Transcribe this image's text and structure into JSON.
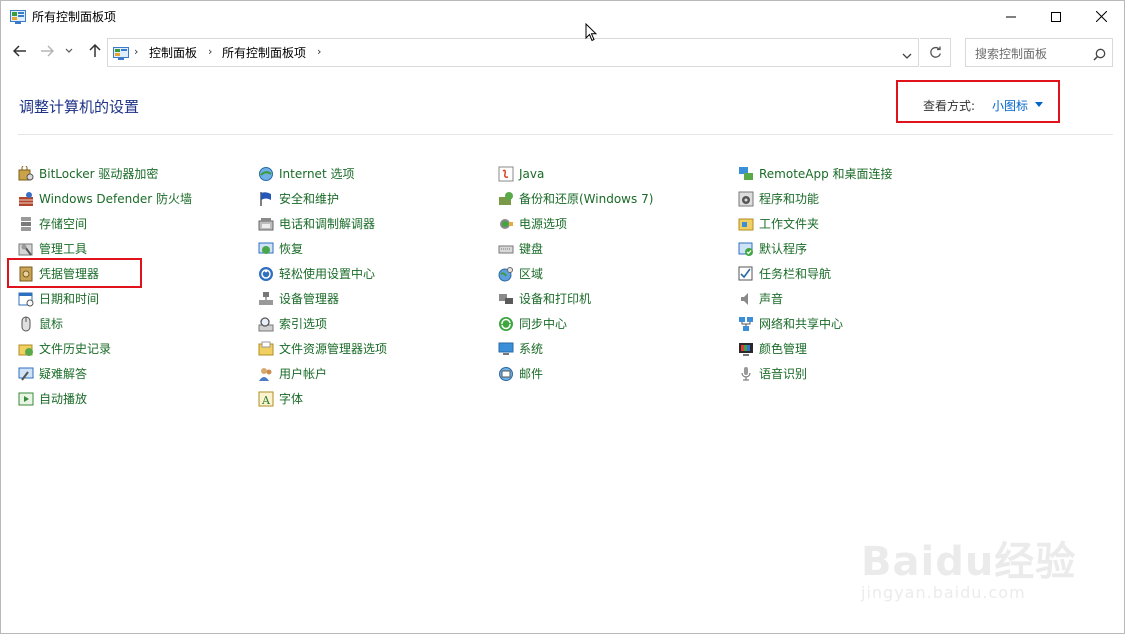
{
  "window": {
    "title": "所有控制面板项"
  },
  "address": {
    "crumbs": [
      "控制面板",
      "所有控制面板项"
    ]
  },
  "search": {
    "placeholder": "搜索控制面板"
  },
  "header": {
    "title": "调整计算机的设置",
    "view_label": "查看方式:",
    "view_value": "小图标"
  },
  "columns": [
    [
      {
        "label": "BitLocker 驱动器加密",
        "icon": "bitlocker-icon"
      },
      {
        "label": "Windows Defender 防火墙",
        "icon": "firewall-icon"
      },
      {
        "label": "存储空间",
        "icon": "storage-spaces-icon"
      },
      {
        "label": "管理工具",
        "icon": "admin-tools-icon"
      },
      {
        "label": "凭据管理器",
        "icon": "credential-manager-icon"
      },
      {
        "label": "日期和时间",
        "icon": "date-time-icon"
      },
      {
        "label": "鼠标",
        "icon": "mouse-icon"
      },
      {
        "label": "文件历史记录",
        "icon": "file-history-icon"
      },
      {
        "label": "疑难解答",
        "icon": "troubleshooting-icon"
      },
      {
        "label": "自动播放",
        "icon": "autoplay-icon"
      }
    ],
    [
      {
        "label": "Internet 选项",
        "icon": "internet-options-icon"
      },
      {
        "label": "安全和维护",
        "icon": "security-maintenance-icon"
      },
      {
        "label": "电话和调制解调器",
        "icon": "phone-modem-icon"
      },
      {
        "label": "恢复",
        "icon": "recovery-icon"
      },
      {
        "label": "轻松使用设置中心",
        "icon": "ease-of-access-icon"
      },
      {
        "label": "设备管理器",
        "icon": "device-manager-icon"
      },
      {
        "label": "索引选项",
        "icon": "indexing-options-icon"
      },
      {
        "label": "文件资源管理器选项",
        "icon": "explorer-options-icon"
      },
      {
        "label": "用户帐户",
        "icon": "user-accounts-icon"
      },
      {
        "label": "字体",
        "icon": "fonts-icon"
      }
    ],
    [
      {
        "label": "Java",
        "icon": "java-icon"
      },
      {
        "label": "备份和还原(Windows 7)",
        "icon": "backup-restore-icon"
      },
      {
        "label": "电源选项",
        "icon": "power-options-icon"
      },
      {
        "label": "键盘",
        "icon": "keyboard-icon"
      },
      {
        "label": "区域",
        "icon": "region-icon"
      },
      {
        "label": "设备和打印机",
        "icon": "devices-printers-icon"
      },
      {
        "label": "同步中心",
        "icon": "sync-center-icon"
      },
      {
        "label": "系统",
        "icon": "system-icon"
      },
      {
        "label": "邮件",
        "icon": "mail-icon"
      }
    ],
    [
      {
        "label": "RemoteApp 和桌面连接",
        "icon": "remoteapp-icon"
      },
      {
        "label": "程序和功能",
        "icon": "programs-features-icon"
      },
      {
        "label": "工作文件夹",
        "icon": "work-folders-icon"
      },
      {
        "label": "默认程序",
        "icon": "default-programs-icon"
      },
      {
        "label": "任务栏和导航",
        "icon": "taskbar-icon"
      },
      {
        "label": "声音",
        "icon": "sound-icon"
      },
      {
        "label": "网络和共享中心",
        "icon": "network-sharing-icon"
      },
      {
        "label": "颜色管理",
        "icon": "color-management-icon"
      },
      {
        "label": "语音识别",
        "icon": "speech-recognition-icon"
      }
    ]
  ],
  "watermark": {
    "brand": "Baidu经验",
    "url": "jingyan.baidu.com"
  },
  "colors": {
    "link": "#1a6b28",
    "title": "#1e3287",
    "accent": "#0066cc",
    "highlight": "#e0121b"
  }
}
